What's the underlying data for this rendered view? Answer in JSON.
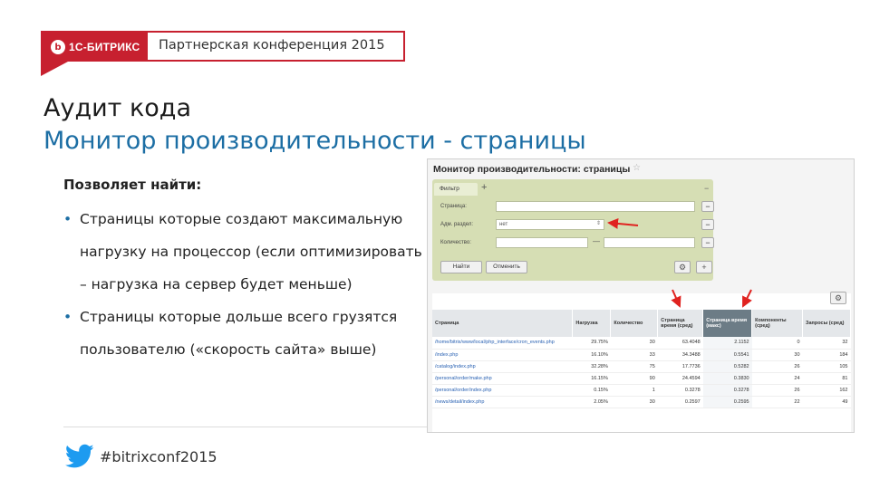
{
  "header": {
    "logo_text": "1С-БИТРИКС",
    "logo_mark": "b",
    "conference": "Партнерская конференция 2015"
  },
  "title": {
    "line1": "Аудит кода",
    "line2": "Монитор производительности - страницы"
  },
  "body": {
    "lead": "Позволяет найти:",
    "bullets": [
      "Страницы которые создают максимальную нагрузку на процессор (если оптимизировать – нагрузка на сервер будет меньше)",
      "Страницы которые дольше всего грузятся пользователю («скорость сайта» выше)"
    ]
  },
  "footer": {
    "hashtag": "#bitrixconf2015",
    "icon": "twitter-bird-icon"
  },
  "screenshot": {
    "title": "Монитор производительности: страницы",
    "star": "☆",
    "filter": {
      "tab_label": "Фильтр",
      "plus": "+",
      "minus": "−",
      "rows": [
        {
          "label": "Страница:",
          "value": ""
        },
        {
          "label": "Адм. раздел:",
          "value": "нет"
        },
        {
          "label": "Количество:",
          "value": ""
        }
      ],
      "range_dash": "—",
      "find_button": "Найти",
      "cancel_button": "Отменить",
      "gear": "⚙"
    },
    "table": {
      "gear": "⚙",
      "headers": [
        "Страница",
        "Нагрузка",
        "Количество",
        "Страница время (сред)",
        "Страница время (макс)",
        "Компоненты (сред)",
        "Запросы (сред)"
      ],
      "sorted_header_index": 4,
      "rows": [
        [
          "/home/bitrix/www/local/php_interface/cron_events.php",
          "29.75%",
          "30",
          "63.4048",
          "2.1152",
          "0",
          "32"
        ],
        [
          "/index.php",
          "16.10%",
          "33",
          "34.3488",
          "0.5541",
          "30",
          "184"
        ],
        [
          "/catalog/index.php",
          "32.28%",
          "75",
          "17.7736",
          "0.5282",
          "26",
          "105"
        ],
        [
          "/personal/order/make.php",
          "16.15%",
          "90",
          "24.4594",
          "0.3830",
          "24",
          "81"
        ],
        [
          "/personal/order/index.php",
          "0.15%",
          "1",
          "0.3278",
          "0.3278",
          "26",
          "162"
        ],
        [
          "/news/detail/index.php",
          "2.05%",
          "30",
          "0.2597",
          "0.2595",
          "22",
          "49"
        ]
      ]
    }
  },
  "colors": {
    "brand_red": "#c7202f",
    "title_blue": "#1c6ea4",
    "filter_green": "#d6deb4",
    "twitter_blue": "#1d9bf0"
  }
}
